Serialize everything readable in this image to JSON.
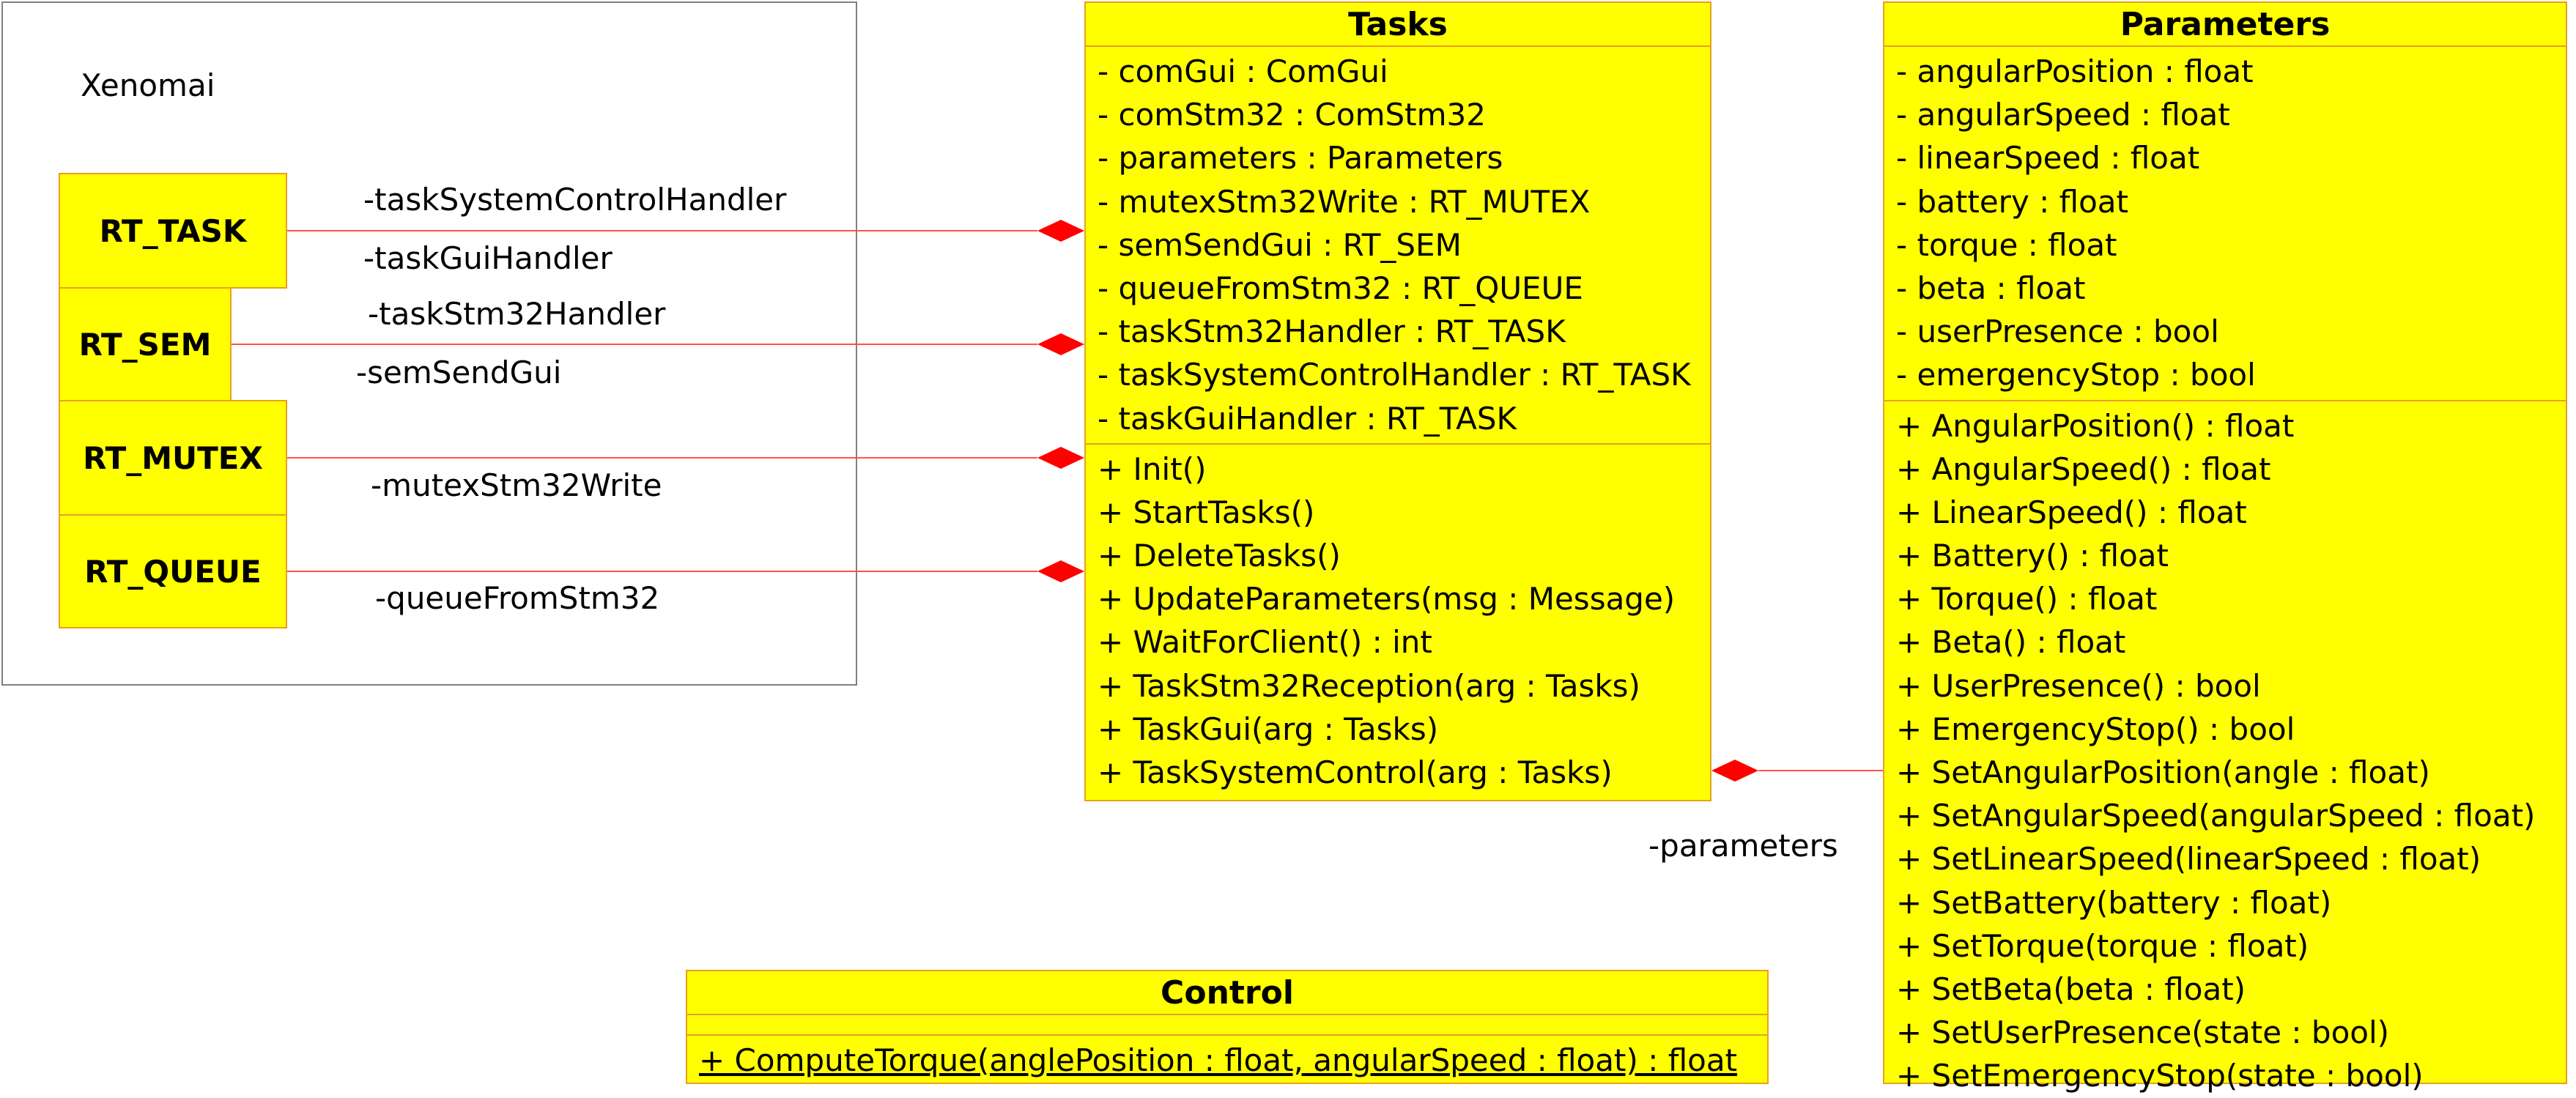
{
  "package": {
    "title": "Xenomai"
  },
  "rt_types": [
    {
      "label": "RT_TASK"
    },
    {
      "label": "RT_SEM"
    },
    {
      "label": "RT_MUTEX"
    },
    {
      "label": "RT_QUEUE"
    }
  ],
  "classes": {
    "tasks": {
      "name": "Tasks",
      "attributes": [
        "- comGui : ComGui",
        "- comStm32 : ComStm32",
        "- parameters : Parameters",
        "- mutexStm32Write : RT_MUTEX",
        "- semSendGui : RT_SEM",
        "- queueFromStm32 : RT_QUEUE",
        "- taskStm32Handler : RT_TASK",
        "- taskSystemControlHandler : RT_TASK",
        "- taskGuiHandler : RT_TASK"
      ],
      "operations": [
        "+ Init()",
        "+ StartTasks()",
        "+ DeleteTasks()",
        "+ UpdateParameters(msg : Message)",
        "+ WaitForClient() : int",
        "+ TaskStm32Reception(arg : Tasks)",
        "+ TaskGui(arg : Tasks)",
        "+ TaskSystemControl(arg : Tasks)"
      ]
    },
    "parameters": {
      "name": "Parameters",
      "attributes": [
        "- angularPosition : float",
        "- angularSpeed : float",
        "- linearSpeed : float",
        "- battery : float",
        "- torque : float",
        "- beta : float",
        "- userPresence : bool",
        "- emergencyStop : bool"
      ],
      "operations": [
        "+ AngularPosition() : float",
        "+ AngularSpeed() : float",
        "+ LinearSpeed() : float",
        "+ Battery() : float",
        "+ Torque() : float",
        "+ Beta() : float",
        "+ UserPresence() : bool",
        "+ EmergencyStop() : bool",
        "+ SetAngularPosition(angle : float)",
        "+ SetAngularSpeed(angularSpeed : float)",
        "+ SetLinearSpeed(linearSpeed : float)",
        "+ SetBattery(battery : float)",
        "+ SetTorque(torque : float)",
        "+ SetBeta(beta : float)",
        "+ SetUserPresence(state : bool)",
        "+ SetEmergencyStop(state : bool)"
      ]
    },
    "control": {
      "name": "Control",
      "operations": [
        "+ ComputeTorque(anglePosition : float, angularSpeed : float) : float"
      ]
    }
  },
  "role_labels": [
    "-taskSystemControlHandler",
    "-taskGuiHandler",
    "-taskStm32Handler",
    "-semSendGui",
    "-mutexStm32Write",
    "-queueFromStm32",
    "-parameters"
  ],
  "colors": {
    "class_fill": "#ffff00",
    "class_border": "#e8a020",
    "association_line": "#ff5050",
    "composition_diamond": "#ff0000",
    "package_border": "#808080"
  }
}
